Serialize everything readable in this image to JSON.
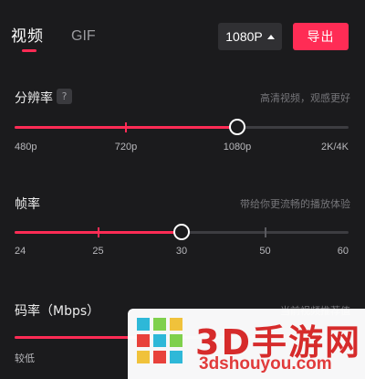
{
  "tabs": [
    {
      "label": "视频",
      "active": true
    },
    {
      "label": "GIF",
      "active": false
    }
  ],
  "resolution_select": {
    "value": "1080P"
  },
  "export_button": {
    "label": "导出"
  },
  "resolution": {
    "title": "分辨率",
    "help": "?",
    "hint": "高清视频，观感更好",
    "labels": [
      "480p",
      "720p",
      "1080p",
      "2K/4K"
    ],
    "selected_index": 2
  },
  "framerate": {
    "title": "帧率",
    "hint": "带给你更流畅的播放体验",
    "labels": [
      "24",
      "25",
      "30",
      "50",
      "60"
    ],
    "selected_index": 2
  },
  "bitrate": {
    "title": "码率（Mbps）",
    "hint": "当前视频推荐值",
    "low_label": "较低"
  },
  "watermark": {
    "text": "3D手游网",
    "url": "3dshouyou.com"
  },
  "colors": {
    "accent": "#ff2c55",
    "background": "#1b1b1d",
    "track": "#3d3d41"
  }
}
